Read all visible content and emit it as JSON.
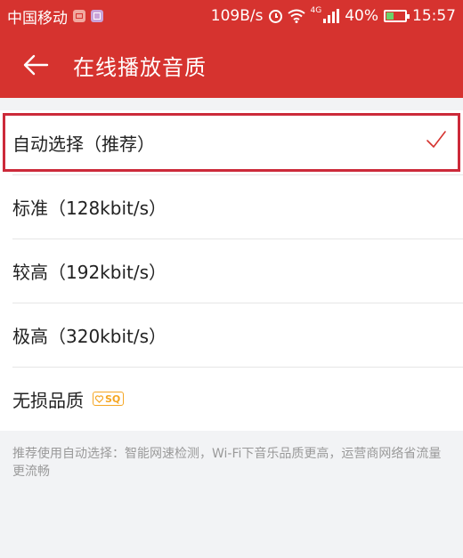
{
  "status_bar": {
    "carrier": "中国移动",
    "net_speed": "109B/s",
    "network_type": "4G",
    "battery": "40%",
    "battery_level": 0.4,
    "time": "15:57"
  },
  "header": {
    "title": "在线播放音质"
  },
  "options": [
    {
      "label": "自动选择（推荐）",
      "selected": true
    },
    {
      "label": "标准（128kbit/s）",
      "selected": false
    },
    {
      "label": "较高（192kbit/s）",
      "selected": false
    },
    {
      "label": "极高（320kbit/s）",
      "selected": false
    },
    {
      "label": "无损品质",
      "selected": false,
      "badge": "SQ"
    }
  ],
  "footer": {
    "note": "推荐使用自动选择：智能网速检测，Wi-Fi下音乐品质更高，运营商网络省流量更流畅"
  },
  "colors": {
    "primary": "#d6332f",
    "selection_outline": "#cc2a3a",
    "badge": "#f5a623",
    "check": "#d6332f"
  }
}
